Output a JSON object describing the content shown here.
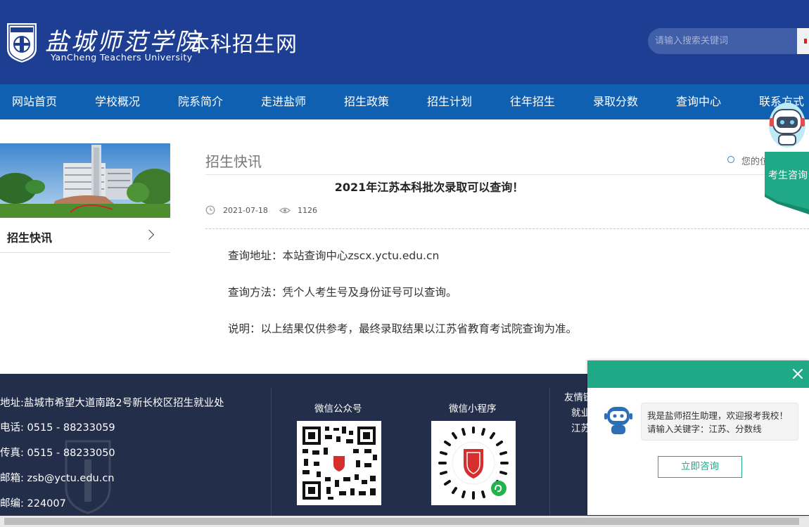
{
  "header": {
    "logo_cn": "盐城师范学院",
    "logo_en": "YanCheng Teachers University",
    "site_title": "本科招生网",
    "search_placeholder": "请输入搜索关键词"
  },
  "nav": {
    "items": [
      "网站首页",
      "学校概况",
      "院系简介",
      "走进盐师",
      "招生政策",
      "招生计划",
      "往年招生",
      "录取分数",
      "查询中心",
      "联系方式"
    ]
  },
  "sidebar": {
    "items": [
      {
        "label": "招生快讯"
      }
    ]
  },
  "content": {
    "section_title": "招生快讯",
    "location_text": "您的位置",
    "article": {
      "title": "2021年江苏本科批次录取可以查询！",
      "date": "2021-07-18",
      "views": "1126",
      "paragraphs": [
        "查询地址：本站查询中心zscx.yctu.edu.cn",
        "查询方法：凭个人考生号及身份证号可以查询。",
        "说明：以上结果仅供参考，最终录取结果以江苏省教育考试院查询为准。"
      ]
    }
  },
  "footer": {
    "address": "地址:盐城市希望大道南路2号新长校区招生就业处",
    "phone": "电话: 0515 - 88233059",
    "fax": "传真: 0515 - 88233050",
    "email": "邮箱: zsb@yctu.edu.cn",
    "postcode": "邮编: 224007",
    "wechat_official_label": "微信公众号",
    "wechat_miniprogram_label": "微信小程序",
    "links_title": "友情链接",
    "links": [
      "就业",
      "江苏"
    ]
  },
  "float_consult": {
    "label": "考生咨询"
  },
  "chat": {
    "greeting": "我是盐师招生助理，欢迎报考我校！请输入关键字：江苏、分数线",
    "button_label": "立即咨询"
  },
  "colors": {
    "header_bg": "#1d3e93",
    "nav_bg": "#1060b1",
    "footer_bg": "#232e4a",
    "chat_accent": "#1fa987"
  }
}
